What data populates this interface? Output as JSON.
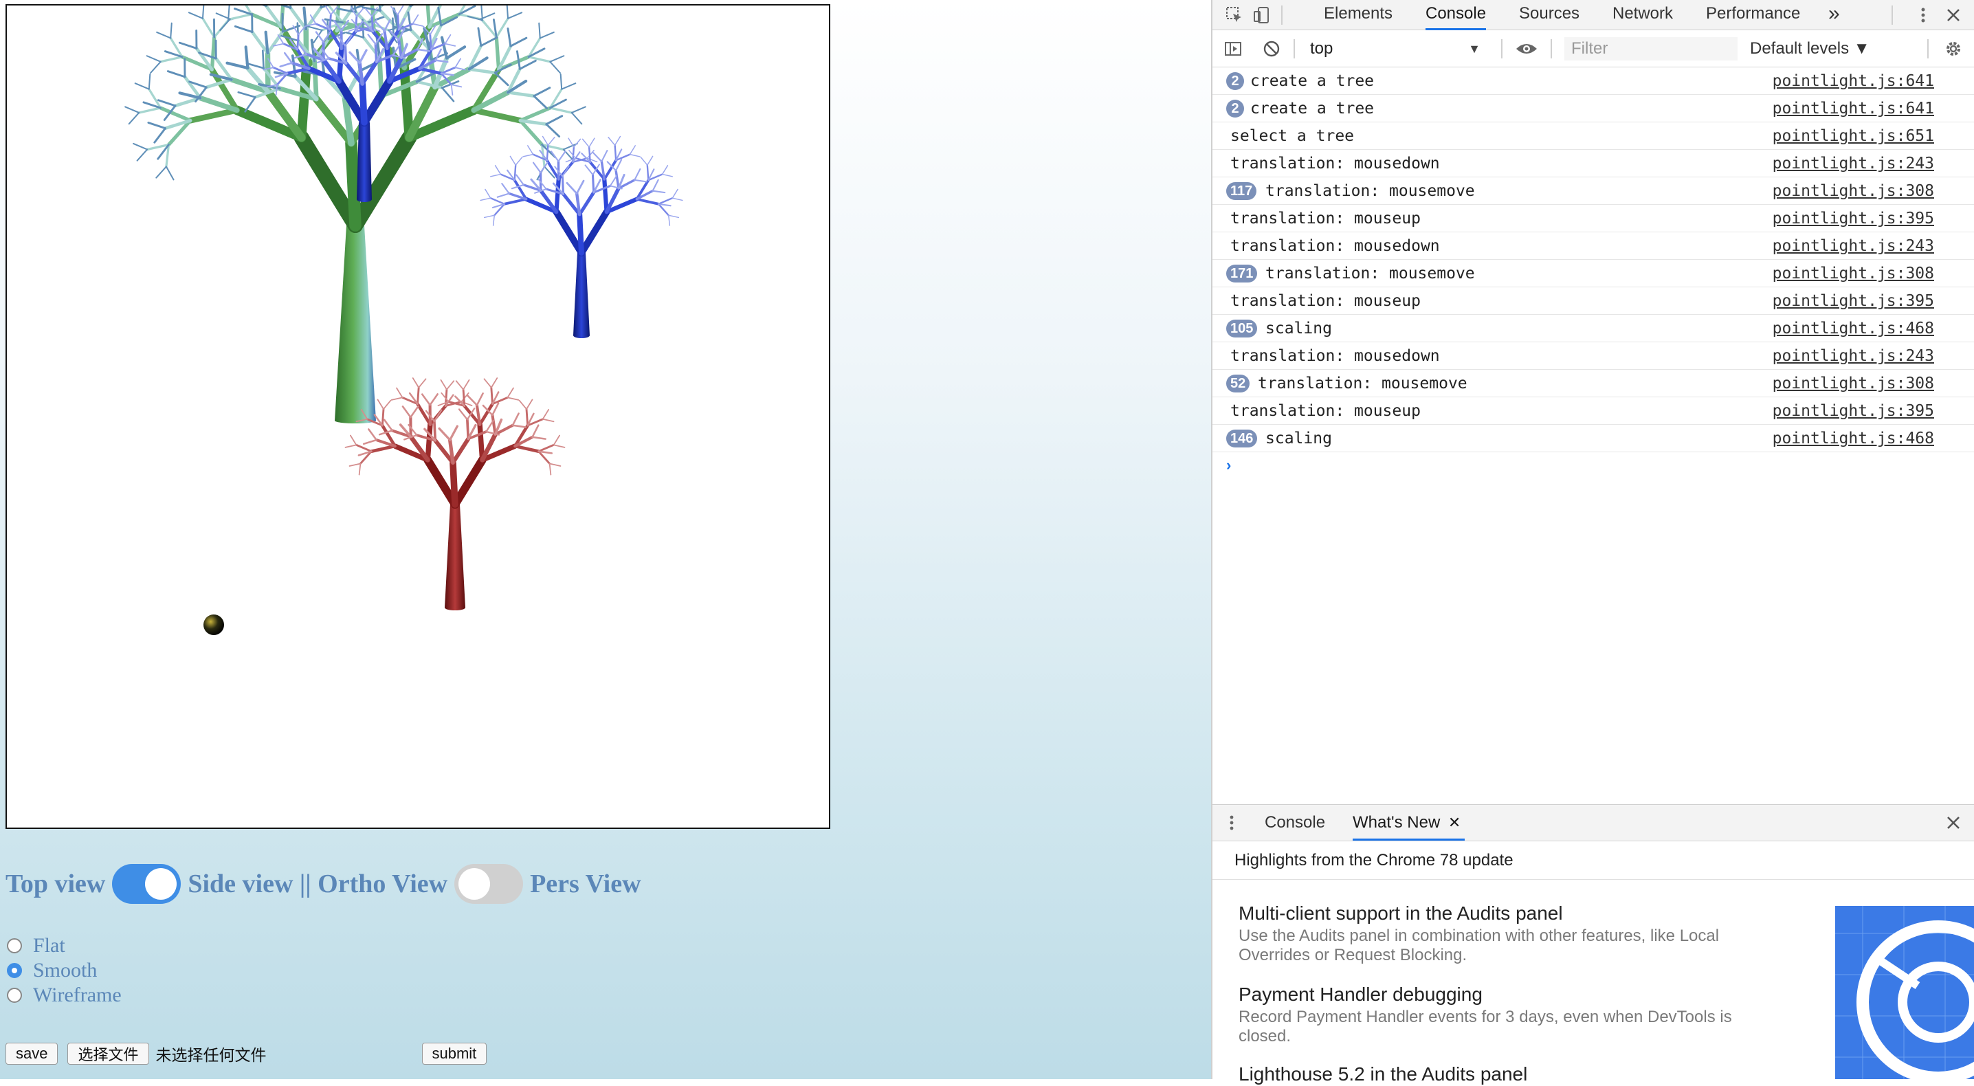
{
  "controls": {
    "top_view": "Top view",
    "side_view": "Side view || Ortho View",
    "pers_view": "Pers View",
    "view_toggle_on": true,
    "proj_toggle_on": false
  },
  "shading": [
    {
      "label": "Flat",
      "checked": false
    },
    {
      "label": "Smooth",
      "checked": true
    },
    {
      "label": "Wireframe",
      "checked": false
    }
  ],
  "form": {
    "save_label": "save",
    "choose_file_label": "选择文件",
    "no_file_text": "未选择任何文件",
    "submit_label": "submit"
  },
  "devtools": {
    "tabs": [
      "Elements",
      "Console",
      "Sources",
      "Network",
      "Performance"
    ],
    "more_tabs": "»",
    "active_tab": "Console",
    "context": "top",
    "filter_placeholder": "Filter",
    "levels": "Default levels ▼",
    "logs": [
      {
        "count": "2",
        "message": "create a tree",
        "source": "pointlight.js:641"
      },
      {
        "count": "2",
        "message": "create a tree",
        "source": "pointlight.js:641"
      },
      {
        "count": "",
        "message": "select a tree",
        "source": "pointlight.js:651"
      },
      {
        "count": "",
        "message": "translation: mousedown",
        "source": "pointlight.js:243"
      },
      {
        "count": "117",
        "message": "translation: mousemove",
        "source": "pointlight.js:308"
      },
      {
        "count": "",
        "message": "translation: mouseup",
        "source": "pointlight.js:395"
      },
      {
        "count": "",
        "message": "translation: mousedown",
        "source": "pointlight.js:243"
      },
      {
        "count": "171",
        "message": "translation: mousemove",
        "source": "pointlight.js:308"
      },
      {
        "count": "",
        "message": "translation: mouseup",
        "source": "pointlight.js:395"
      },
      {
        "count": "105",
        "message": "scaling",
        "source": "pointlight.js:468"
      },
      {
        "count": "",
        "message": "translation: mousedown",
        "source": "pointlight.js:243"
      },
      {
        "count": "52",
        "message": "translation: mousemove",
        "source": "pointlight.js:308"
      },
      {
        "count": "",
        "message": "translation: mouseup",
        "source": "pointlight.js:395"
      },
      {
        "count": "146",
        "message": "scaling",
        "source": "pointlight.js:468"
      }
    ],
    "prompt": "›",
    "drawer_tabs": [
      "Console",
      "What's New"
    ],
    "drawer_active": "What's New",
    "drawer_heading": "Highlights from the Chrome 78 update",
    "news": [
      {
        "title": "Multi-client support in the Audits panel",
        "desc": "Use the Audits panel in combination with other features, like Local Overrides or Request Blocking."
      },
      {
        "title": "Payment Handler debugging",
        "desc": "Record Payment Handler events for 3 days, even when DevTools is closed."
      },
      {
        "title": "Lighthouse 5.2 in the Audits panel",
        "desc": ""
      }
    ]
  },
  "colors": {
    "accent": "#1a73e8",
    "label_blue": "#5b87b8",
    "toggle_on": "#3f8ee6",
    "badge": "#7b90b8",
    "tree_green": "#3f8c3a",
    "tree_blue": "#1a2fb0",
    "tree_red": "#8e1a1a"
  }
}
